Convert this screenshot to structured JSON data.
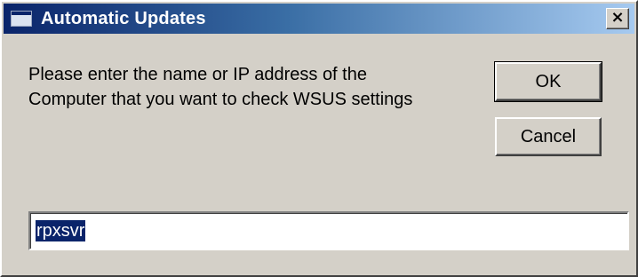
{
  "window": {
    "title": "Automatic Updates",
    "close_label": "×"
  },
  "prompt": {
    "line1": "Please enter the name or IP address of the",
    "line2": "Computer that you want to check WSUS settings"
  },
  "buttons": {
    "ok_label": "OK",
    "cancel_label": "Cancel"
  },
  "input": {
    "value": "rpxsvr",
    "selected": true
  },
  "colors": {
    "titlebar_start": "#0a246a",
    "titlebar_end": "#a6caf0",
    "dialog_face": "#d4d0c8",
    "selection": "#0a246a"
  },
  "icons": {
    "app": "window-icon",
    "close": "close-icon"
  }
}
